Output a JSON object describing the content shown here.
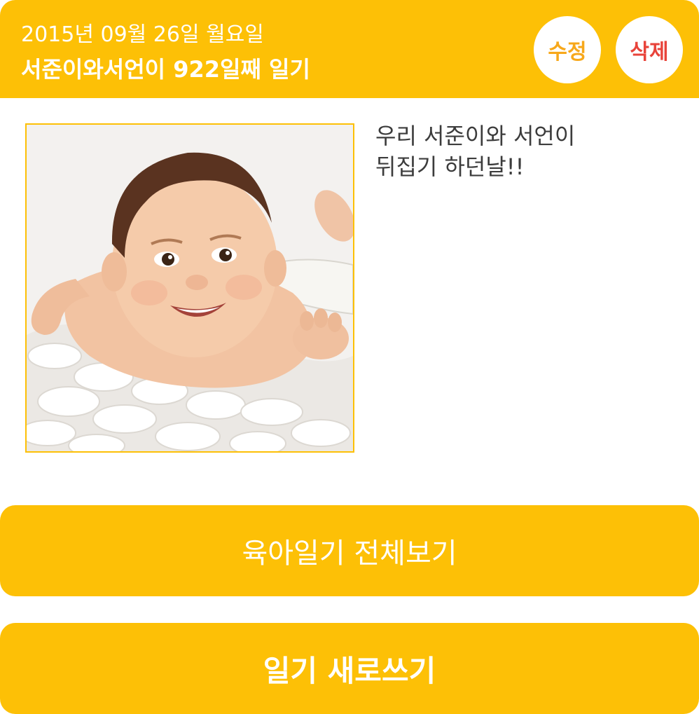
{
  "header": {
    "date": "2015년 09월 26일 월요일",
    "title": "서준이와서언이 922일째 일기",
    "edit_label": "수정",
    "delete_label": "삭제"
  },
  "diary": {
    "text": "우리 서준이와 서언이\n뒤집기 하던날!!",
    "photo_icon": "baby-photo"
  },
  "actions": {
    "view_all_label": "육아일기 전체보기",
    "new_entry_label": "일기 새로쓰기"
  },
  "colors": {
    "accent": "#FDC006",
    "edit_text": "#F7A81B",
    "delete_text": "#E8433A",
    "body_text": "#3c3c3c"
  }
}
